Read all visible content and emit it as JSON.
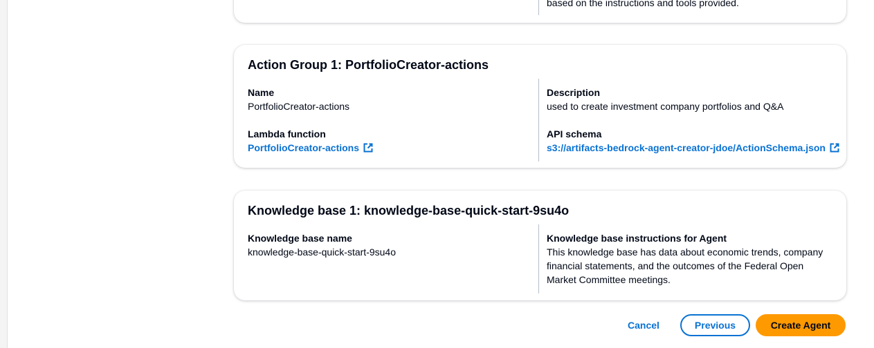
{
  "agent_card": {
    "instructions_tail": "based on the instructions and tools provided."
  },
  "action_group": {
    "title": "Action Group 1: PortfolioCreator-actions",
    "name_label": "Name",
    "name_value": "PortfolioCreator-actions",
    "description_label": "Description",
    "description_value": "used to create investment company portfolios and Q&A",
    "lambda_label": "Lambda function",
    "lambda_value": "PortfolioCreator-actions",
    "schema_label": "API schema",
    "schema_value": "s3://artifacts-bedrock-agent-creator-jdoe/ActionSchema.json"
  },
  "knowledge_base": {
    "title": "Knowledge base 1: knowledge-base-quick-start-9su4o",
    "name_label": "Knowledge base name",
    "name_value": "knowledge-base-quick-start-9su4o",
    "instructions_label": "Knowledge base instructions for Agent",
    "instructions_lines": [
      "This knowledge base has data about economic trends, company",
      "financial statements, and the outcomes of the Federal Open",
      "Market Committee meetings."
    ]
  },
  "footer": {
    "cancel_label": "Cancel",
    "previous_label": "Previous",
    "create_label": "Create Agent"
  },
  "colors": {
    "link": "#0972d3",
    "primary_button": "#ff9900",
    "text": "#000716"
  }
}
